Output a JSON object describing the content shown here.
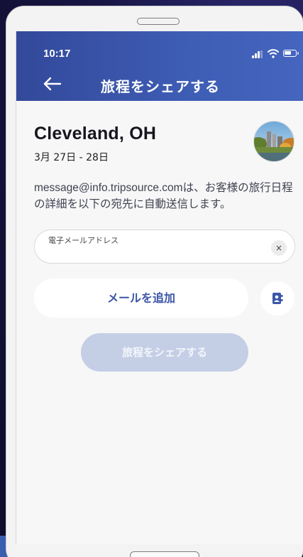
{
  "status_bar": {
    "time": "10:17",
    "icons": [
      "signal-bars-icon",
      "wifi-icon",
      "battery-icon"
    ]
  },
  "header": {
    "back_icon": "back-arrow-icon",
    "title": "旅程をシェアする"
  },
  "trip": {
    "city": "Cleveland, OH",
    "dates": "3月 27日 - 28日"
  },
  "message": "message@info.tripsource.comは、お客様の旅行日程の詳細を以下の宛先に自動送信します。",
  "email_field": {
    "label": "電子メールアドレス",
    "value": "",
    "clear_glyph": "×"
  },
  "actions": {
    "add_email_label": "メールを追加",
    "contacts_icon": "contact-book-icon",
    "share_label": "旅程をシェアする"
  },
  "colors": {
    "header_blue": "#3e5db5",
    "accent_text": "#3b56a8",
    "disabled_button": "#c4cfe6"
  }
}
